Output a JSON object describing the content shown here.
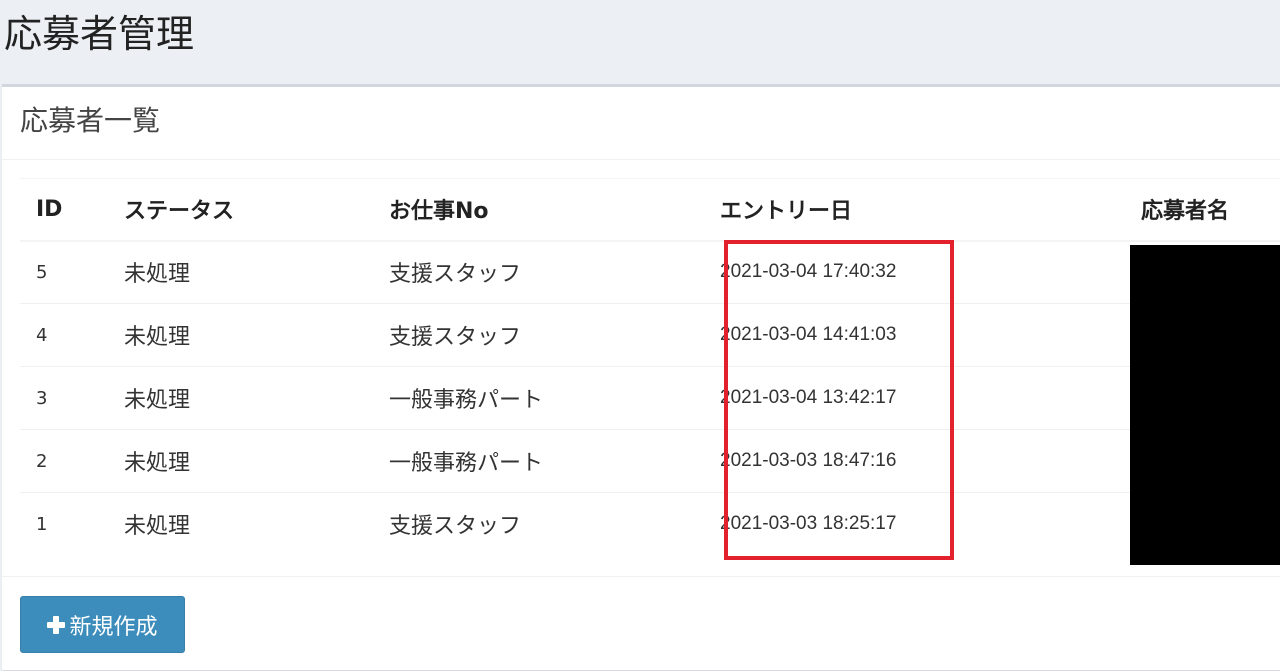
{
  "page": {
    "title": "応募者管理"
  },
  "box": {
    "title": "応募者一覧"
  },
  "table": {
    "columns": {
      "id": "ID",
      "status": "ステータス",
      "job_no": "お仕事No",
      "entry_date": "エントリー日",
      "applicant_name": "応募者名"
    },
    "rows": [
      {
        "id": "5",
        "status": "未処理",
        "job_no": "支援スタッフ",
        "entry_date": "2021-03-04 17:40:32"
      },
      {
        "id": "4",
        "status": "未処理",
        "job_no": "支援スタッフ",
        "entry_date": "2021-03-04 14:41:03"
      },
      {
        "id": "3",
        "status": "未処理",
        "job_no": "一般事務パート",
        "entry_date": "2021-03-04 13:42:17"
      },
      {
        "id": "2",
        "status": "未処理",
        "job_no": "一般事務パート",
        "entry_date": "2021-03-03 18:47:16"
      },
      {
        "id": "1",
        "status": "未処理",
        "job_no": "支援スタッフ",
        "entry_date": "2021-03-03 18:25:17"
      }
    ]
  },
  "footer": {
    "create_button_label": "新規作成",
    "create_button_icon": "plus-icon"
  },
  "colors": {
    "background": "#ecf0f5",
    "button": "#3c8dbc",
    "highlight": "#e3212d"
  }
}
